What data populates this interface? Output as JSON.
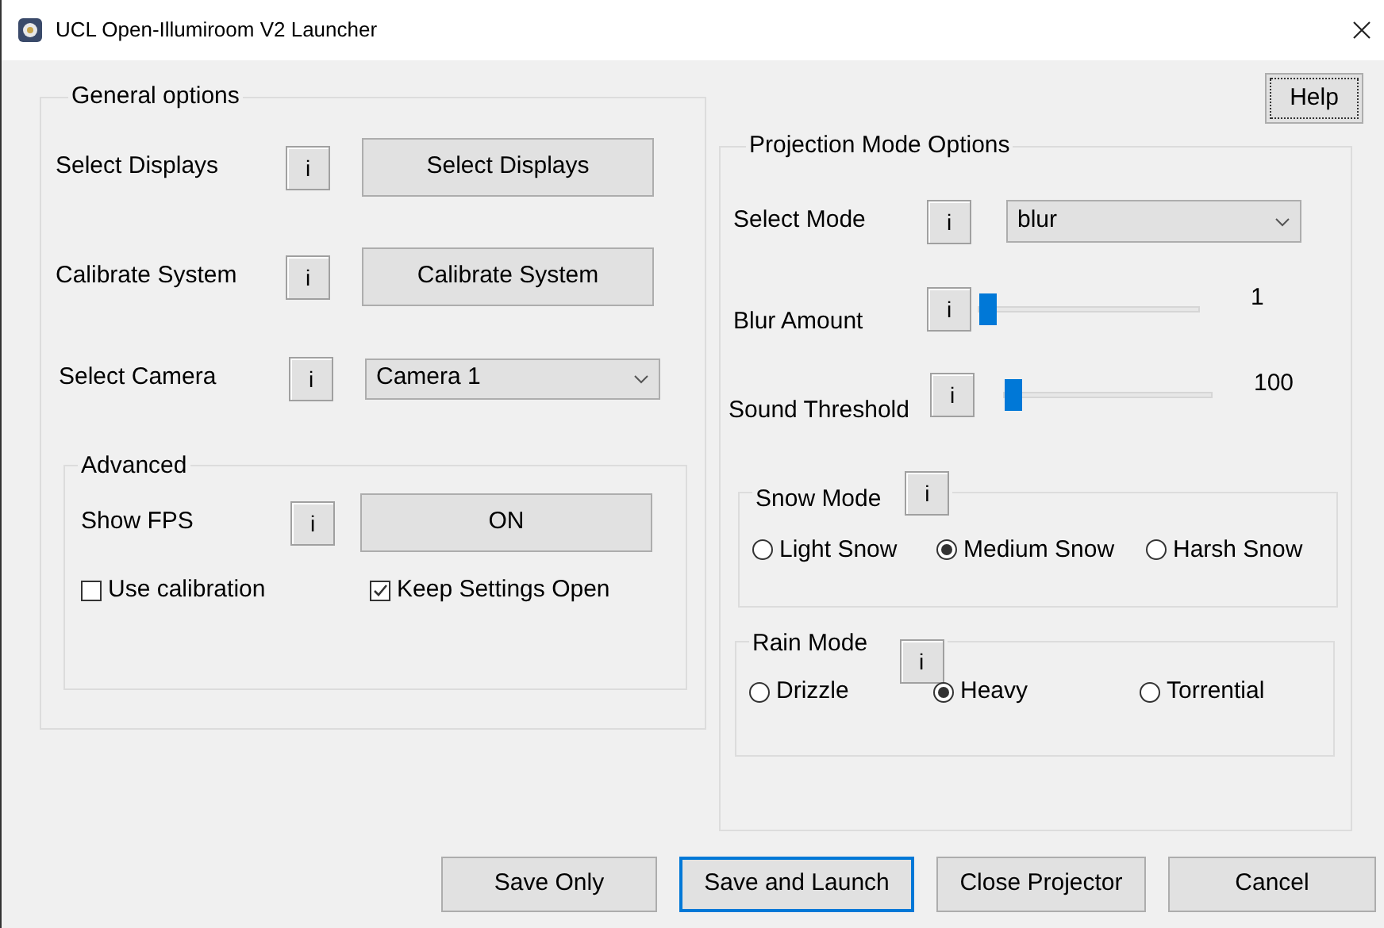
{
  "window": {
    "title": "UCL Open-Illumiroom V2 Launcher"
  },
  "help_button": "Help",
  "general_options": {
    "title": "General options",
    "rows": [
      {
        "kind": "button",
        "label": "Select Displays",
        "info": "i",
        "control": "Select Displays"
      },
      {
        "kind": "button",
        "label": "Calibrate System",
        "info": "i",
        "control": "Calibrate System"
      },
      {
        "kind": "dropdown",
        "label": "Select Camera",
        "info": "i",
        "control": "Camera 1"
      }
    ],
    "advanced": {
      "title": "Advanced",
      "show_fps": {
        "label": "Show FPS",
        "info": "i",
        "button": "ON"
      },
      "checkboxes": [
        {
          "label": "Use calibration",
          "checked": false
        },
        {
          "label": "Keep Settings Open",
          "checked": true
        }
      ]
    }
  },
  "projection": {
    "title": "Projection Mode Options",
    "mode": {
      "label": "Select Mode",
      "info": "i",
      "value": "blur"
    },
    "sliders": [
      {
        "label": "Blur Amount",
        "info": "i",
        "level": 0,
        "reading": "1"
      },
      {
        "label": "Sound Threshold",
        "info": "i",
        "level": 0,
        "reading": "100"
      }
    ],
    "radio_groups": [
      {
        "title": "Snow Mode",
        "info": "i",
        "options": [
          {
            "label": "Light Snow",
            "selected": false
          },
          {
            "label": "Medium Snow",
            "selected": true
          },
          {
            "label": "Harsh Snow",
            "selected": false
          }
        ]
      },
      {
        "title": "Rain Mode",
        "info": "i",
        "options": [
          {
            "label": "Drizzle",
            "selected": false
          },
          {
            "label": "Heavy",
            "selected": true
          },
          {
            "label": "Torrential",
            "selected": false
          }
        ]
      }
    ]
  },
  "buttons": [
    {
      "label": "Save Only",
      "default": false
    },
    {
      "label": "Save and Launch",
      "default": true
    },
    {
      "label": "Close Projector",
      "default": false
    },
    {
      "label": "Cancel",
      "default": false
    }
  ]
}
